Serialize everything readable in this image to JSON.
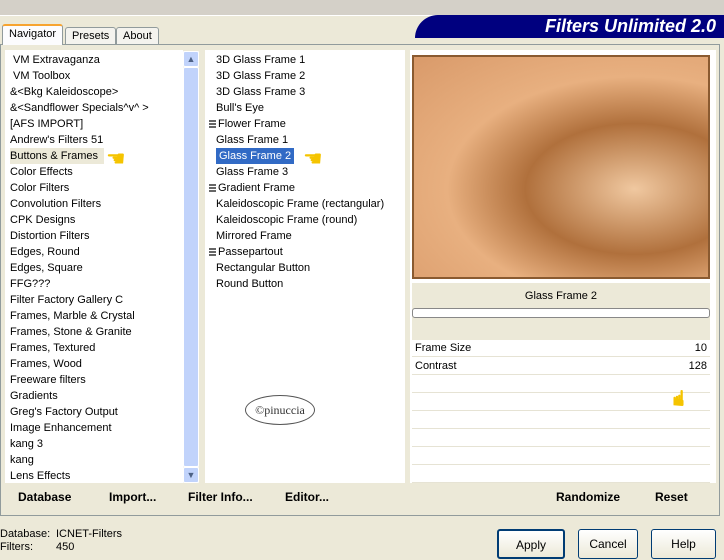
{
  "title": "Filters Unlimited 2.0",
  "tabs": [
    "Navigator",
    "Presets",
    "About"
  ],
  "categories": [
    "VM Extravaganza",
    "VM Toolbox",
    "&<Bkg Kaleidoscope>",
    "&<Sandflower Specials^v^ >",
    "[AFS IMPORT]",
    "Andrew's Filters 51",
    "Buttons & Frames",
    "Color Effects",
    "Color Filters",
    "Convolution Filters",
    "CPK Designs",
    "Distortion Filters",
    "Edges, Round",
    "Edges, Square",
    "FFG???",
    "Filter Factory Gallery C",
    "Frames, Marble & Crystal",
    "Frames, Stone & Granite",
    "Frames, Textured",
    "Frames, Wood",
    "Freeware filters",
    "Gradients",
    "Greg's Factory Output",
    "Image Enhancement",
    "kang 3",
    "kang",
    "Lens Effects"
  ],
  "filters": [
    "3D Glass Frame 1",
    "3D Glass Frame 2",
    "3D Glass Frame 3",
    "Bull's Eye",
    "Flower Frame",
    "Glass Frame 1",
    "Glass Frame 2",
    "Glass Frame 3",
    "Gradient Frame",
    "Kaleidoscopic Frame (rectangular)",
    "Kaleidoscopic Frame (round)",
    "Mirrored Frame",
    "Passepartout",
    "Rectangular Button",
    "Round Button"
  ],
  "watermark": "©pinuccia",
  "selected_filter": "Glass Frame 2",
  "params": [
    {
      "label": "Frame Size",
      "value": "10"
    },
    {
      "label": "Contrast",
      "value": "128"
    }
  ],
  "buttons": {
    "database": "Database",
    "import": "Import...",
    "filter_info": "Filter Info...",
    "editor": "Editor...",
    "randomize": "Randomize",
    "reset": "Reset",
    "apply": "Apply",
    "cancel": "Cancel",
    "help": "Help"
  },
  "status": {
    "database_label": "Database:",
    "database_value": "ICNET-Filters",
    "filters_label": "Filters:",
    "filters_value": "450"
  }
}
